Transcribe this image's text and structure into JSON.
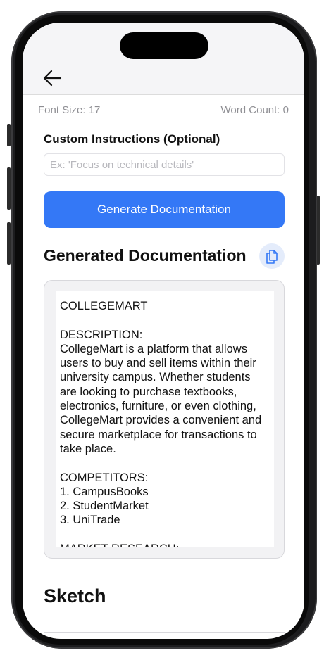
{
  "meta": {
    "font_size": "Font Size: 17",
    "word_count": "Word Count: 0"
  },
  "custom_instructions": {
    "label": "Custom Instructions (Optional)",
    "placeholder": "Ex: 'Focus on technical details'",
    "value": ""
  },
  "generate_button": {
    "label": "Generate Documentation"
  },
  "generated": {
    "title": "Generated Documentation",
    "content": "COLLEGEMART\n\nDESCRIPTION:\nCollegeMart is a platform that allows users to buy and sell items within their university campus. Whether students are looking to purchase textbooks, electronics, furniture, or even clothing, CollegeMart provides a convenient and secure marketplace for transactions to take place.\n\nCOMPETITORS:\n1. CampusBooks\n2. StudentMarket\n3. UniTrade\n\nMARKET RESEARCH:"
  },
  "sketch": {
    "title": "Sketch"
  },
  "icons": {
    "back": "arrow-left-icon",
    "copy": "copy-document-icon"
  },
  "colors": {
    "accent": "#3478f6",
    "copy_bg": "#e4ecfb"
  }
}
